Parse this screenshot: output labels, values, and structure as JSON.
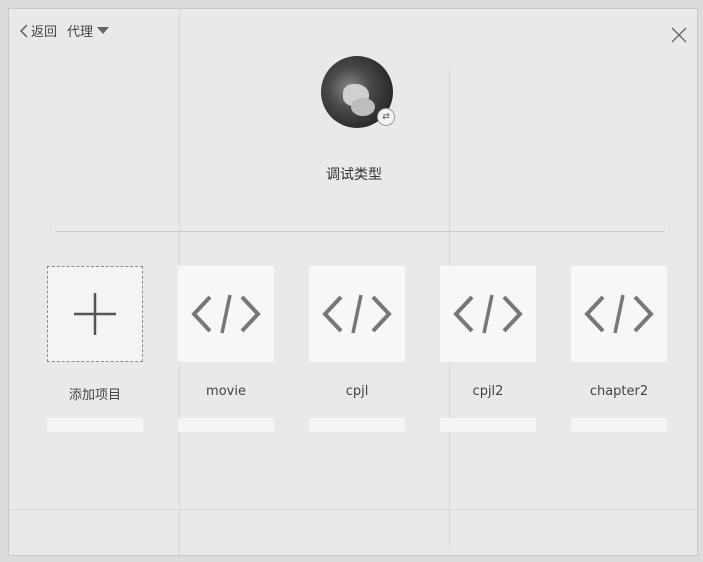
{
  "header": {
    "back_label": "返回",
    "proxy_label": "代理"
  },
  "icons": {
    "back": "chevron-left-icon",
    "proxy_caret": "caret-down-icon",
    "close": "close-icon",
    "add": "plus-icon",
    "code": "code-icon",
    "avatar_badge": "switch-icon"
  },
  "profile": {
    "title": "调试类型"
  },
  "items": [
    {
      "label": "添加项目",
      "kind": "add"
    },
    {
      "label": "movie",
      "kind": "project"
    },
    {
      "label": "cpjl",
      "kind": "project"
    },
    {
      "label": "cpjl2",
      "kind": "project"
    },
    {
      "label": "chapter2",
      "kind": "project"
    }
  ]
}
